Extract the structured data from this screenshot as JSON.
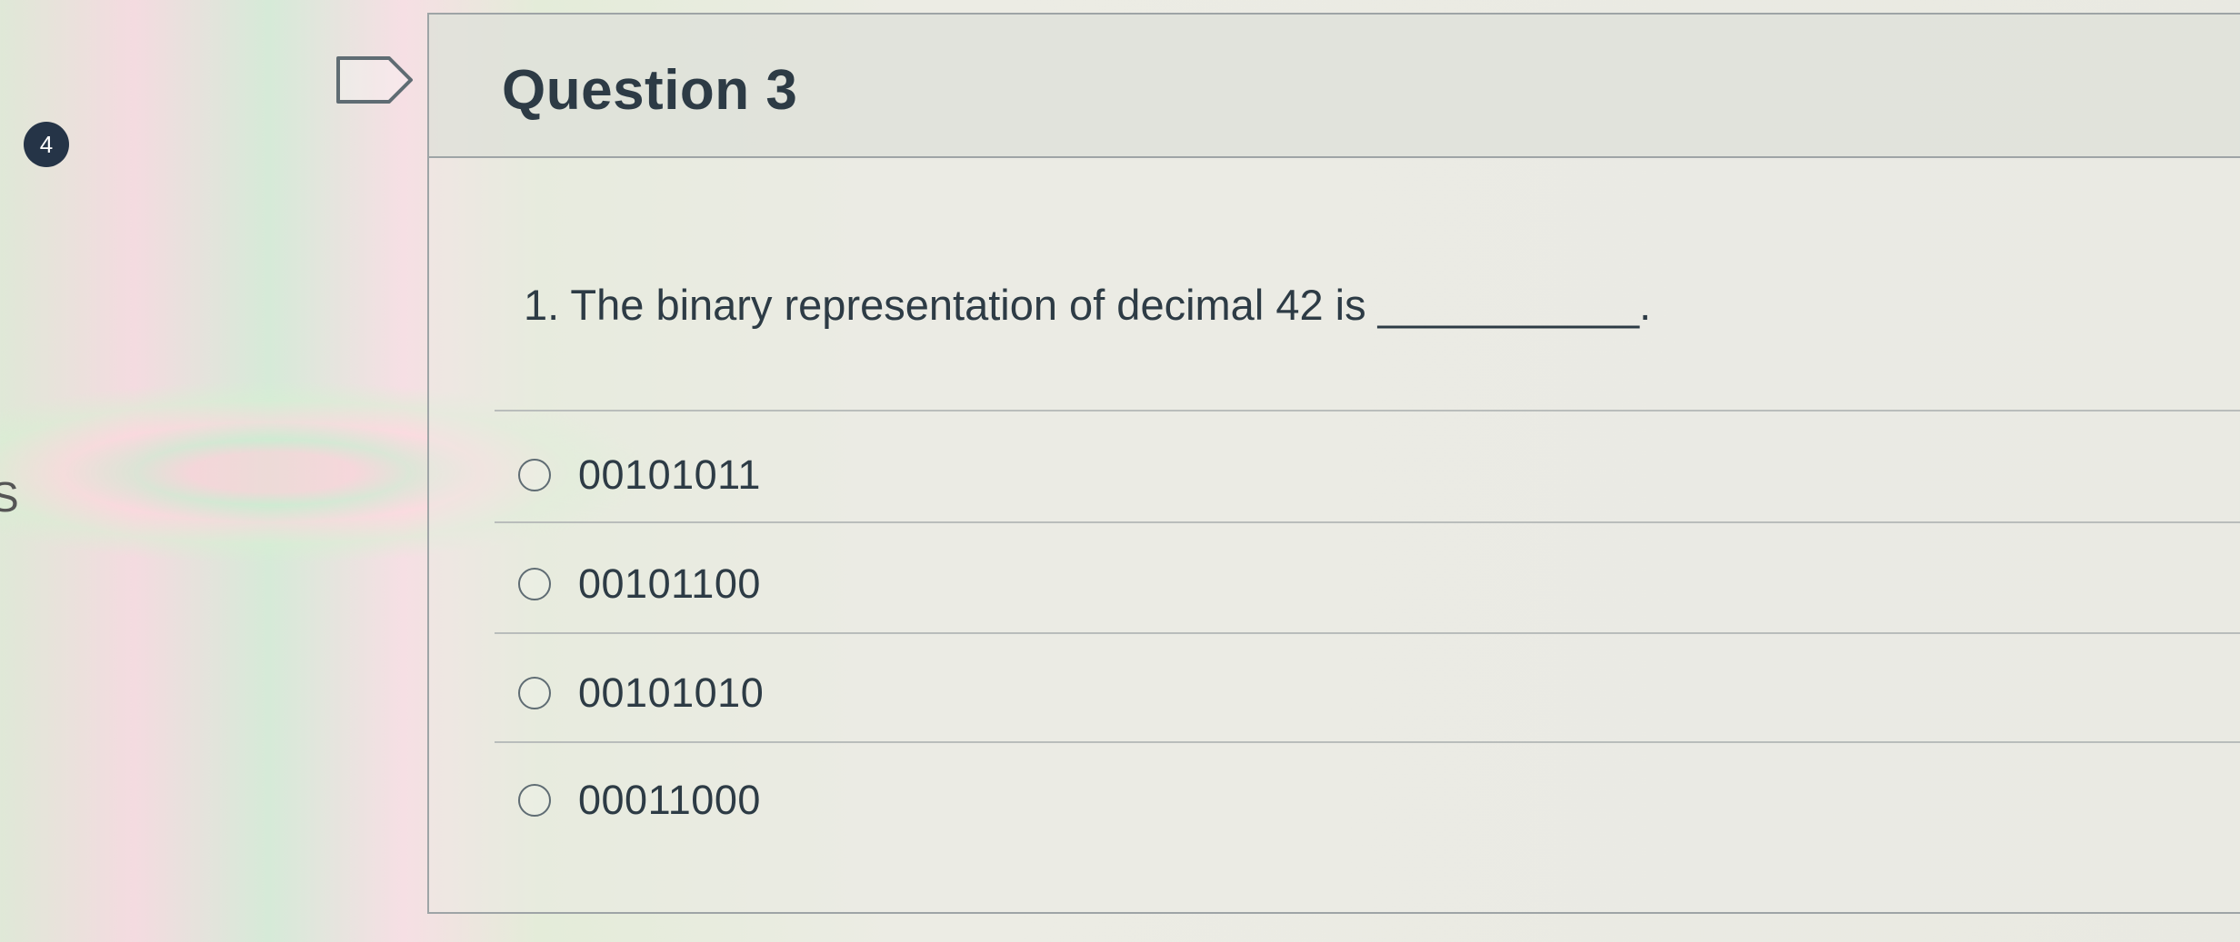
{
  "nav": {
    "question_number": "4",
    "edge_letter": "S"
  },
  "question": {
    "title": "Question 3",
    "text": "1. The binary representation of decimal 42 is ___________."
  },
  "answers": [
    {
      "label": "00101011"
    },
    {
      "label": "00101100"
    },
    {
      "label": "00101010"
    },
    {
      "label": "00011000"
    }
  ],
  "icons": {
    "flag": "flag-icon",
    "radio": "radio-button-icon"
  },
  "colors": {
    "text": "#2d3b45",
    "badge": "#253447",
    "border": "#9ea4a6"
  }
}
